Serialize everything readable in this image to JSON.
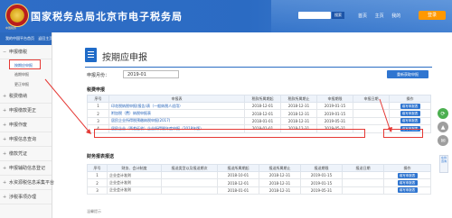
{
  "header": {
    "title": "国家税务总局北京市电子税务局",
    "logo_sub": "中国税务",
    "search_button": "搜索",
    "links": [
      "首页",
      "主页",
      "我的"
    ],
    "login_button": "登录"
  },
  "sidebar": {
    "top": [
      "我的中国平台首页",
      "返回主页"
    ],
    "items": [
      {
        "label": "申报缴税",
        "open": true,
        "children": [
          {
            "label": "按期应申报",
            "active": true
          },
          {
            "label": "逾期申报",
            "active": false
          },
          {
            "label": "更正申报",
            "active": false
          }
        ]
      },
      {
        "label": "税费缴纳",
        "open": false,
        "children": []
      },
      {
        "label": "申报缴款更正",
        "open": false,
        "children": []
      },
      {
        "label": "申报作废",
        "open": false,
        "children": []
      },
      {
        "label": "申报信息查询",
        "open": false,
        "children": []
      },
      {
        "label": "缴款凭证",
        "open": false,
        "children": []
      },
      {
        "label": "申报辅助信息登记",
        "open": false,
        "children": []
      },
      {
        "label": "水资源税信息采集平台",
        "open": false,
        "children": []
      },
      {
        "label": "涉税事项办理",
        "open": false,
        "children": []
      }
    ]
  },
  "main": {
    "title": "按期应申报",
    "period_label": "申报月份：",
    "period_value": "2019-01",
    "refresh_button": "重新获取申报",
    "tax_section": "税费申报",
    "tax_headers": [
      "序号",
      "申报表",
      "税款所属期起",
      "税款所属期止",
      "申报期限",
      "申报日期",
      "操作"
    ],
    "tax_rows": [
      [
        "1",
        "印花税纳税申报(报告)表（一般纳税人适用）",
        "2018-12-01",
        "2018-12-31",
        "2019-01-15",
        "",
        "填写申报表"
      ],
      [
        "2",
        "附加税（费）纳税申报表",
        "2018-12-01",
        "2018-12-31",
        "2019-01-15",
        "",
        "填写申报表"
      ],
      [
        "3",
        "居民企业所得税预缴纳税申报(2017)",
        "2018-01-01",
        "2018-12-31",
        "2019-05-31",
        "",
        "填写申报表"
      ],
      [
        "4",
        "居民企业（两差征收）企业所得税年度申报（2018年版）",
        "2018-01-01",
        "2018-12-31",
        "2019-05-31",
        "",
        "填写申报表"
      ]
    ],
    "finance_section": "财务报表报送",
    "finance_headers": [
      "序号",
      "财务、会计制度",
      "报送类型以及报送期次",
      "报送所属期起",
      "报送所属期止",
      "报送期限",
      "报送日期",
      "操作"
    ],
    "finance_rows": [
      [
        "1",
        "企业会计准则",
        "",
        "2018-10-01",
        "2018-12-31",
        "2019-01-15",
        "",
        "填写申报表"
      ],
      [
        "2",
        "企业会计准则",
        "",
        "2018-12-01",
        "2018-12-31",
        "2019-01-15",
        "",
        "填写申报表"
      ],
      [
        "3",
        "企业会计准则",
        "",
        "2018-01-01",
        "2018-12-31",
        "2019-05-31",
        "",
        "填写申报表"
      ]
    ],
    "note": "温馨提示"
  },
  "float_tab": "在线咨询",
  "colors": {
    "header_blue": "#2b6bc3",
    "accent_orange": "#ff9800",
    "highlight_red": "#e53935",
    "button_blue": "#2f75d0"
  },
  "icons": [
    "logo-emblem",
    "document-icon",
    "refresh-icon",
    "back-to-top-icon",
    "chat-icon",
    "help-icon"
  ]
}
